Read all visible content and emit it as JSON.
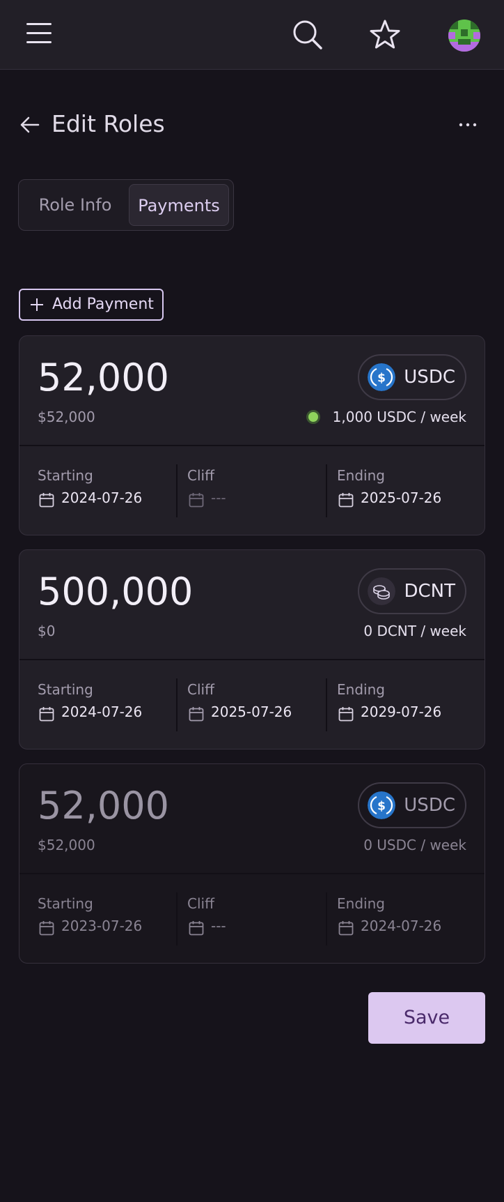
{
  "header": {
    "title": "Edit Roles"
  },
  "tabs": [
    {
      "label": "Role Info"
    },
    {
      "label": "Payments"
    }
  ],
  "add_payment_label": "Add Payment",
  "payments": [
    {
      "amount": "52,000",
      "fiat": "$52,000",
      "token": "USDC",
      "rate": "1,000 USDC / week",
      "active": true,
      "starting_label": "Starting",
      "starting": "2024-07-26",
      "cliff_label": "Cliff",
      "cliff": "---",
      "ending_label": "Ending",
      "ending": "2025-07-26"
    },
    {
      "amount": "500,000",
      "fiat": "$0",
      "token": "DCNT",
      "rate": "0 DCNT / week",
      "active": false,
      "starting_label": "Starting",
      "starting": "2024-07-26",
      "cliff_label": "Cliff",
      "cliff": "2025-07-26",
      "ending_label": "Ending",
      "ending": "2029-07-26"
    },
    {
      "amount": "52,000",
      "fiat": "$52,000",
      "token": "USDC",
      "rate": "0 USDC / week",
      "active": false,
      "starting_label": "Starting",
      "starting": "2023-07-26",
      "cliff_label": "Cliff",
      "cliff": "---",
      "ending_label": "Ending",
      "ending": "2024-07-26"
    }
  ],
  "save_label": "Save",
  "colors": {
    "background": "#16131b",
    "accent": "#dcc8f0",
    "usdc": "#2775ca",
    "active_dot": "#8fd35c"
  },
  "icons": [
    "menu-icon",
    "search-icon",
    "star-icon",
    "avatar",
    "back-arrow-icon",
    "more-icon",
    "plus-icon",
    "usdc-icon",
    "dcnt-coins-icon",
    "calendar-icon"
  ]
}
